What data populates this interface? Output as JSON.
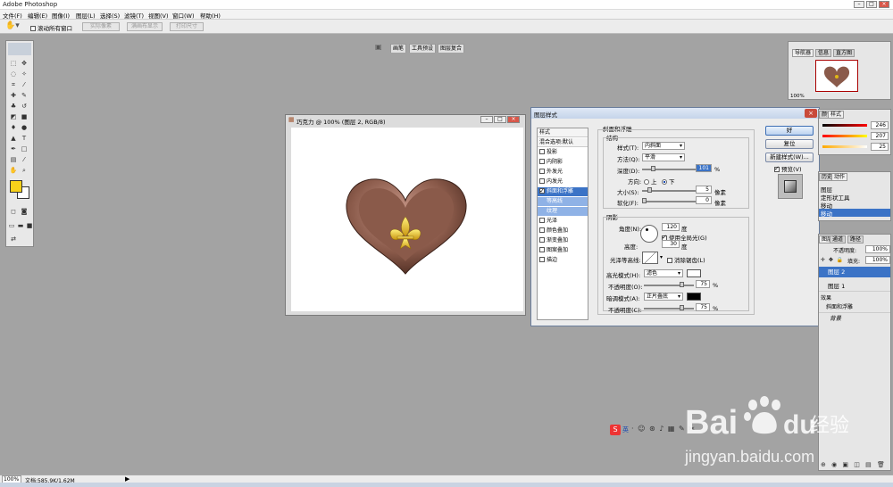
{
  "app": {
    "title": "Adobe Photoshop"
  },
  "menu": [
    "文件(F)",
    "编辑(E)",
    "图像(I)",
    "图层(L)",
    "选择(S)",
    "滤镜(T)",
    "视图(V)",
    "窗口(W)",
    "帮助(H)"
  ],
  "options_bar": {
    "scroll_all": "滚动所有窗口",
    "actual_pixels": "实际像素",
    "fit_screen": "满画布显示",
    "print_size": "打印尺寸"
  },
  "palette_well_tabs": [
    "画笔",
    "工具预设",
    "图层复合"
  ],
  "document": {
    "title": "巧克力 @ 100% (图层 2, RGB/8)"
  },
  "dialog": {
    "title": "图层样式",
    "styles_header": "样式",
    "blend_options": "混合选项:默认",
    "style_items": [
      {
        "label": "投影",
        "checked": false
      },
      {
        "label": "内阴影",
        "checked": false
      },
      {
        "label": "外发光",
        "checked": false
      },
      {
        "label": "内发光",
        "checked": false
      },
      {
        "label": "斜面和浮雕",
        "checked": true
      },
      {
        "label": "等高线",
        "sub": true
      },
      {
        "label": "纹理",
        "sub": true
      },
      {
        "label": "光泽",
        "checked": false
      },
      {
        "label": "颜色叠加",
        "checked": false
      },
      {
        "label": "渐变叠加",
        "checked": false
      },
      {
        "label": "图案叠加",
        "checked": false
      },
      {
        "label": "描边",
        "checked": false
      }
    ],
    "bevel_title": "斜面和浮雕",
    "structure_title": "结构",
    "style_label": "样式(T):",
    "style_value": "内斜面",
    "technique_label": "方法(Q):",
    "technique_value": "平滑",
    "depth_label": "深度(D):",
    "depth_value": "101",
    "percent": "%",
    "direction_label": "方向:",
    "dir_up": "上",
    "dir_down": "下",
    "size_label": "大小(S):",
    "size_value": "5",
    "soften_label": "软化(F):",
    "soften_value": "0",
    "px": "像素",
    "shading_title": "阴影",
    "angle_label": "角度(N):",
    "angle_value": "120",
    "degree": "度",
    "global_light": "使用全局光(G)",
    "altitude_label": "高度:",
    "altitude_value": "30",
    "gloss_contour_label": "光泽等高线:",
    "anti_aliased": "消除锯齿(L)",
    "highlight_mode_label": "高光模式(H):",
    "highlight_mode_value": "滤色",
    "opacity_label": "不透明度(O):",
    "highlight_opacity": "75",
    "shadow_mode_label": "暗调模式(A):",
    "shadow_mode_value": "正片叠底",
    "shadow_opacity_label": "不透明度(C):",
    "shadow_opacity": "75",
    "buttons": {
      "ok": "好",
      "reset": "复位",
      "new_style": "新建样式(W)...",
      "preview": "预览(V)"
    }
  },
  "navigator_panel": {
    "tabs": [
      "导航器",
      "信息",
      "直方图"
    ],
    "zoom": "100%"
  },
  "color_panel": {
    "tabs": [
      "颜色",
      "样式"
    ],
    "values": [
      "246",
      "207",
      "25"
    ]
  },
  "history_panel": {
    "tabs": [
      "历史记录",
      "动作"
    ],
    "items": [
      "图层",
      "定形状工具",
      "移动",
      "移动"
    ]
  },
  "layers_panel": {
    "tabs": [
      "图层",
      "通道",
      "路径"
    ],
    "opacity_label": "不透明度:",
    "opacity": "100%",
    "fill_label": "填充:",
    "fill": "100%",
    "layers": [
      "图层 2",
      "图层 1",
      "效果",
      "斜面和浮雕",
      "背景"
    ]
  },
  "status": {
    "zoom": "100%",
    "doc": "文档:585.9K/1.62M"
  },
  "ime": {
    "label": "英"
  },
  "watermark": {
    "brand": "Bai",
    "brand2": "du",
    "cn": "经验",
    "url": "jingyan.baidu.com"
  },
  "colors": {
    "heart": "#8a5a4a",
    "fleur": "#e0b814",
    "foreground": "#f7d11a",
    "dialog_accent": "#3b73c6"
  }
}
